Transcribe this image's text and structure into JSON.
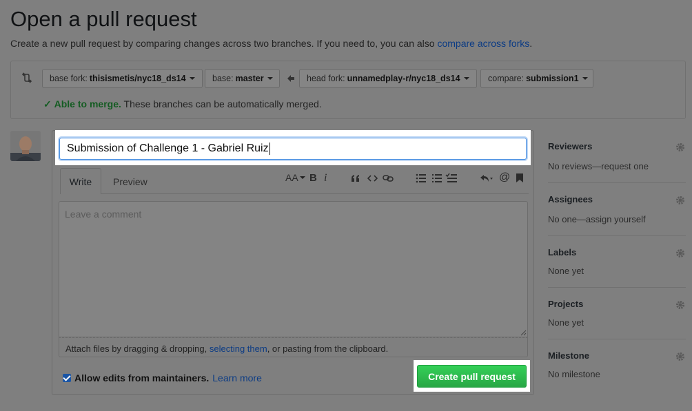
{
  "page": {
    "title": "Open a pull request",
    "subtitle_text": "Create a new pull request by comparing changes across two branches. If you need to, you can also ",
    "subtitle_link": "compare across forks",
    "subtitle_end": "."
  },
  "range": {
    "base_fork_label": "base fork:",
    "base_fork_value": "thisismetis/nyc18_ds14",
    "base_label": "base:",
    "base_value": "master",
    "head_fork_label": "head fork:",
    "head_fork_value": "unnamedplay-r/nyc18_ds14",
    "compare_label": "compare:",
    "compare_value": "submission1",
    "merge_status": "Able to merge.",
    "merge_text": "These branches can be automatically merged."
  },
  "form": {
    "title_value": "Submission of Challenge 1 - Gabriel Ruiz",
    "tab_write": "Write",
    "tab_preview": "Preview",
    "comment_placeholder": "Leave a comment",
    "attach_text_1": "Attach files by dragging & dropping, ",
    "attach_link": "selecting them",
    "attach_text_2": ", or pasting from the clipboard.",
    "allow_edits_label": "Allow edits from maintainers.",
    "learn_more": "Learn more",
    "create_button": "Create pull request"
  },
  "toolbar": {
    "header_icon": "AA",
    "bold_icon": "B",
    "italic_icon": "i",
    "at_icon": "@"
  },
  "sidebar": {
    "reviewers": {
      "label": "Reviewers",
      "value": "No reviews—request one"
    },
    "assignees": {
      "label": "Assignees",
      "value": "No one—assign yourself"
    },
    "labels": {
      "label": "Labels",
      "value": "None yet"
    },
    "projects": {
      "label": "Projects",
      "value": "None yet"
    },
    "milestone": {
      "label": "Milestone",
      "value": "No milestone"
    }
  },
  "colors": {
    "overlay": "#7f7f7f",
    "primary_button": "#28a745",
    "link": "#0b3b84",
    "merge_ok": "#145c22"
  }
}
